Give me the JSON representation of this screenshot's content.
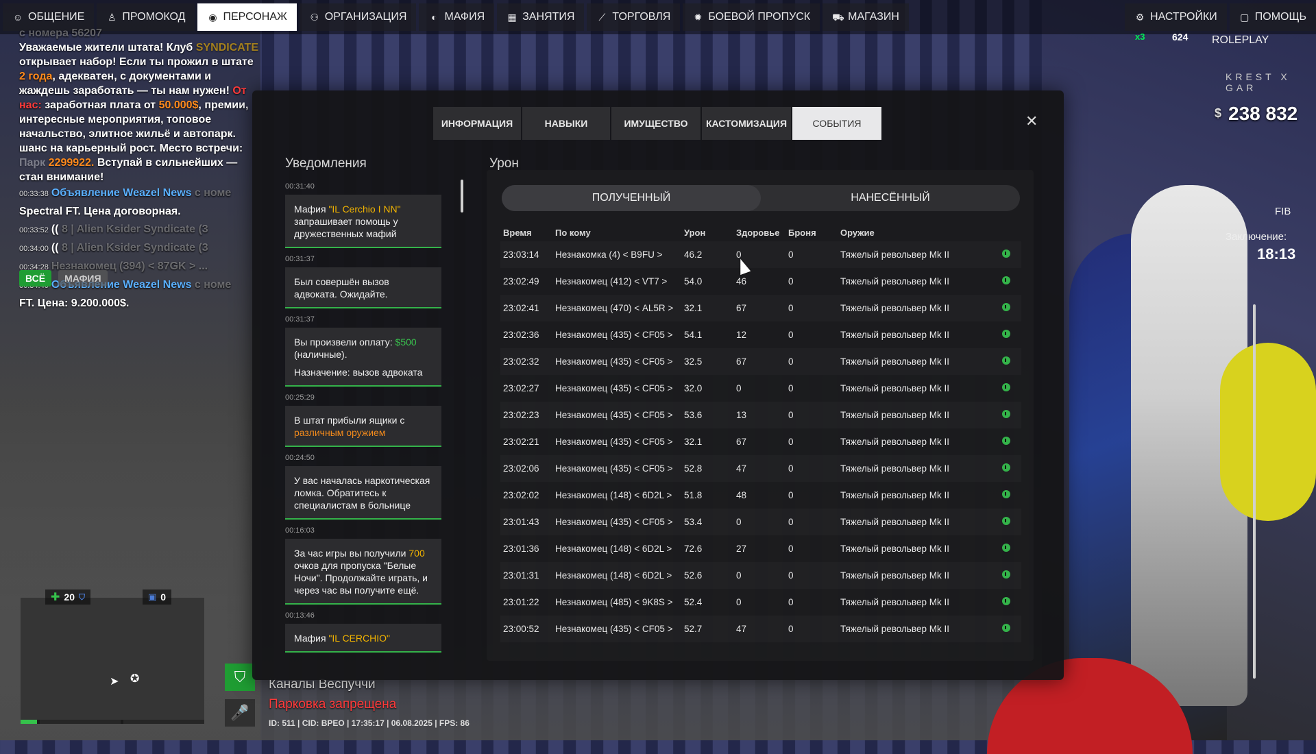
{
  "nav": {
    "left": [
      {
        "label": "ОБЩЕНИЕ",
        "icon": "chat-icon"
      },
      {
        "label": "ПРОМОКОД",
        "icon": "person-icon"
      },
      {
        "label": "ПЕРСОНАЖ",
        "icon": "user-icon",
        "active": true
      },
      {
        "label": "ОРГАНИЗАЦИЯ",
        "icon": "group-icon"
      },
      {
        "label": "МАФИЯ",
        "icon": "mask-icon"
      },
      {
        "label": "ЗАНЯТИЯ",
        "icon": "calendar-icon"
      },
      {
        "label": "ТОРГОВЛЯ",
        "icon": "chart-icon"
      },
      {
        "label": "БОЕВОЙ ПРОПУСК",
        "icon": "star-icon"
      },
      {
        "label": "МАГАЗИН",
        "icon": "cart-icon"
      }
    ],
    "right": [
      {
        "label": "НАСТРОЙКИ",
        "icon": "gear-icon"
      },
      {
        "label": "ПОМОЩЬ",
        "icon": "help-icon"
      }
    ]
  },
  "chat": {
    "header_fade": "с номера 56207",
    "ad": {
      "p1": "Уважаемые жители штата! Клуб",
      "club": "SYNDICATE",
      "p2": "открывает набор! Если ты прожил в штате",
      "years": "2 года",
      "p3": ", адекватен, с документами и жаждешь заработать — ты нам нужен!",
      "from_us": "От нас:",
      "p4": "заработная плата от",
      "salary": "50.000$",
      "p5": ", премии, интересные мероприятия, топовое начальство, элитное жильё и автопарк. шанс на карьерный рост. Место встречи:",
      "place": "Парк",
      "phone": "2299922.",
      "p6": "Вступай в сильнейших — стан внимание!"
    },
    "lines": [
      {
        "time": "00:33:38",
        "blue": "Объявление Weazel News",
        "fade": "с номе"
      },
      {
        "time": "",
        "text": "Spectral FT. Цена договорная."
      },
      {
        "time": "00:33:52",
        "text": "((",
        "fade": "8 | Alien Ksider Syndicate (3"
      },
      {
        "time": "00:34:00",
        "text": "((",
        "fade": "8 | Alien Ksider Syndicate (3"
      },
      {
        "time": "00:34:28",
        "text": "",
        "fade": "Незнакомец (394) < 87GK > ..."
      },
      {
        "time": "00:34:40",
        "blue": "Объявление Weazel News",
        "fade": "с номе"
      },
      {
        "time": "",
        "text": "FT. Цена: 9.200.000$."
      }
    ],
    "tabs": [
      "ВСЁ",
      "МАФИЯ"
    ]
  },
  "hud": {
    "health": "20",
    "armor": "0",
    "location": "Каналы Веспуччи",
    "warning": "Парковка запрещена",
    "info": "ID: 511 | CID: BPEO | 17:35:17    | 06.08.2025 | FPS: 86",
    "money_currency": "$",
    "money": "238 832",
    "server": "ROLEPLAY",
    "server_name": "KREST X GAR",
    "badge_mult": "x3",
    "badge_num": "624",
    "fib": "FIB",
    "jail_label": "Заключение:",
    "jail_time": "18:13"
  },
  "modal": {
    "tabs": [
      "ИНФОРМАЦИЯ",
      "НАВЫКИ",
      "ИМУЩЕСТВО",
      "КАСТОМИЗАЦИЯ",
      "СОБЫТИЯ"
    ],
    "active_tab": "СОБЫТИЯ",
    "notifications_title": "Уведомления",
    "damage_title": "Урон",
    "seg": [
      "ПОЛУЧЕННЫЙ",
      "НАНЕСЁННЫЙ"
    ],
    "columns": [
      "Время",
      "По кому",
      "Урон",
      "Здоровье",
      "Броня",
      "Оружие"
    ],
    "notifications": [
      {
        "time": "00:31:40",
        "parts": [
          [
            "",
            "Мафия "
          ],
          [
            "y",
            "\"IL Cerchio I NN\""
          ],
          [
            "",
            " запрашивает помощь у дружественных мафий"
          ]
        ]
      },
      {
        "time": "00:31:37",
        "parts": [
          [
            "",
            "Был совершён вызов адвоката. Ожидайте."
          ]
        ]
      },
      {
        "time": "00:31:37",
        "parts": [
          [
            "",
            "Вы произвели оплату: "
          ],
          [
            "g",
            "$500"
          ],
          [
            "",
            " (наличные)."
          ]
        ],
        "extra": "Назначение: вызов адвоката"
      },
      {
        "time": "00:25:29",
        "parts": [
          [
            "",
            "В штат прибыли ящики с "
          ],
          [
            "o",
            "различным оружием"
          ]
        ]
      },
      {
        "time": "00:24:50",
        "parts": [
          [
            "",
            "У вас началась наркотическая ломка. Обратитесь к специалистам в больнице"
          ]
        ]
      },
      {
        "time": "00:16:03",
        "parts": [
          [
            "",
            "За час игры вы получили "
          ],
          [
            "y",
            "700"
          ],
          [
            "",
            " очков для пропуска \"Белые Ночи\". Продолжайте играть, и через час вы получите ещё."
          ]
        ]
      },
      {
        "time": "00:13:46",
        "parts": [
          [
            "",
            "Мафия "
          ],
          [
            "y",
            "\"IL CERCHIO\""
          ]
        ]
      }
    ],
    "rows": [
      {
        "time": "23:03:14",
        "who": "Незнакомка (4) < B9FU >",
        "dmg": "46.2",
        "hp": "0",
        "armor": "0",
        "weapon": "Тяжелый револьвер Mk II"
      },
      {
        "time": "23:02:49",
        "who": "Незнакомец (412) < VT7 >",
        "dmg": "54.0",
        "hp": "46",
        "armor": "0",
        "weapon": "Тяжелый револьвер Mk II"
      },
      {
        "time": "23:02:41",
        "who": "Незнакомец (470) < AL5R >",
        "dmg": "32.1",
        "hp": "67",
        "armor": "0",
        "weapon": "Тяжелый револьвер Mk II"
      },
      {
        "time": "23:02:36",
        "who": "Незнакомец (435) < CF05 >",
        "dmg": "54.1",
        "hp": "12",
        "armor": "0",
        "weapon": "Тяжелый револьвер Mk II"
      },
      {
        "time": "23:02:32",
        "who": "Незнакомец (435) < CF05 >",
        "dmg": "32.5",
        "hp": "67",
        "armor": "0",
        "weapon": "Тяжелый револьвер Mk II"
      },
      {
        "time": "23:02:27",
        "who": "Незнакомец (435) < CF05 >",
        "dmg": "32.0",
        "hp": "0",
        "armor": "0",
        "weapon": "Тяжелый револьвер Mk II"
      },
      {
        "time": "23:02:23",
        "who": "Незнакомец (435) < CF05 >",
        "dmg": "53.6",
        "hp": "13",
        "armor": "0",
        "weapon": "Тяжелый револьвер Mk II"
      },
      {
        "time": "23:02:21",
        "who": "Незнакомец (435) < CF05 >",
        "dmg": "32.1",
        "hp": "67",
        "armor": "0",
        "weapon": "Тяжелый револьвер Mk II"
      },
      {
        "time": "23:02:06",
        "who": "Незнакомец (435) < CF05 >",
        "dmg": "52.8",
        "hp": "47",
        "armor": "0",
        "weapon": "Тяжелый револьвер Mk II"
      },
      {
        "time": "23:02:02",
        "who": "Незнакомец (148) < 6D2L >",
        "dmg": "51.8",
        "hp": "48",
        "armor": "0",
        "weapon": "Тяжелый револьвер Mk II"
      },
      {
        "time": "23:01:43",
        "who": "Незнакомец (435) < CF05 >",
        "dmg": "53.4",
        "hp": "0",
        "armor": "0",
        "weapon": "Тяжелый револьвер Mk II"
      },
      {
        "time": "23:01:36",
        "who": "Незнакомец (148) < 6D2L >",
        "dmg": "72.6",
        "hp": "27",
        "armor": "0",
        "weapon": "Тяжелый револьвер Mk II"
      },
      {
        "time": "23:01:31",
        "who": "Незнакомец (148) < 6D2L >",
        "dmg": "52.6",
        "hp": "0",
        "armor": "0",
        "weapon": "Тяжелый револьвер Mk II"
      },
      {
        "time": "23:01:22",
        "who": "Незнакомец (485) < 9K8S >",
        "dmg": "52.4",
        "hp": "0",
        "armor": "0",
        "weapon": "Тяжелый револьвер Mk II"
      },
      {
        "time": "23:00:52",
        "who": "Незнакомец (435) < CF05 >",
        "dmg": "52.7",
        "hp": "47",
        "armor": "0",
        "weapon": "Тяжелый револьвер Mk II"
      }
    ]
  },
  "colors": {
    "accent_green": "#34b34a",
    "warning_red": "#ff3b3b",
    "highlight_yellow": "#f2b400"
  }
}
